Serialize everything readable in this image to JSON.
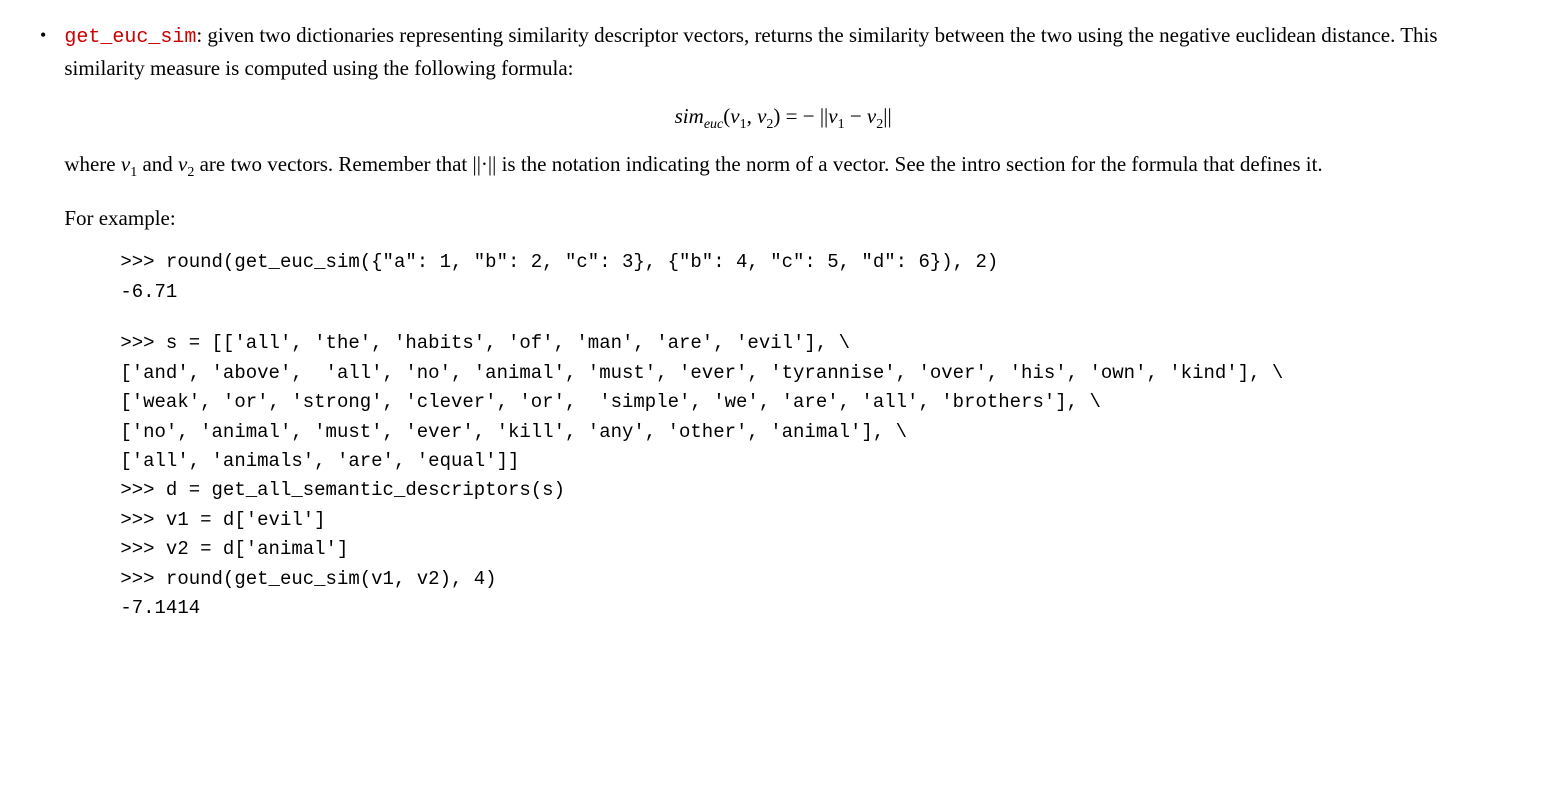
{
  "bullet": "•",
  "funcName": "get_euc_sim",
  "descLine1a": ": given two dictionaries representing similarity descriptor vectors, returns the similarity between the two using the negative euclidean distance. This similarity measure is computed using the following formula:",
  "formula": {
    "lhs1": "sim",
    "lhs_sub": "euc",
    "lhs2": "(v",
    "lhs2sub": "1",
    "lhs3": ", v",
    "lhs3sub": "2",
    "lhs4": ") = − ||v",
    "lhs4sub": "1",
    "lhs5": " − v",
    "lhs5sub": "2",
    "lhs6": "||"
  },
  "descLine2a": "where ",
  "descLine2v1": "v",
  "descLine2v1sub": "1",
  "descLine2b": " and ",
  "descLine2v2": "v",
  "descLine2v2sub": "2",
  "descLine2c": " are two vectors. Remember that ||·|| is the notation indicating the norm of a vector. See the intro section for the formula that defines it.",
  "exampleLabel": "For example:",
  "codeBlock1": ">>> round(get_euc_sim({\"a\": 1, \"b\": 2, \"c\": 3}, {\"b\": 4, \"c\": 5, \"d\": 6}), 2)\n-6.71",
  "codeBlock2": ">>> s = [['all', 'the', 'habits', 'of', 'man', 'are', 'evil'], \\\n['and', 'above',  'all', 'no', 'animal', 'must', 'ever', 'tyrannise', 'over', 'his', 'own', 'kind'], \\\n['weak', 'or', 'strong', 'clever', 'or',  'simple', 'we', 'are', 'all', 'brothers'], \\\n['no', 'animal', 'must', 'ever', 'kill', 'any', 'other', 'animal'], \\\n['all', 'animals', 'are', 'equal']]\n>>> d = get_all_semantic_descriptors(s)\n>>> v1 = d['evil']\n>>> v2 = d['animal']\n>>> round(get_euc_sim(v1, v2), 4)\n-7.1414"
}
